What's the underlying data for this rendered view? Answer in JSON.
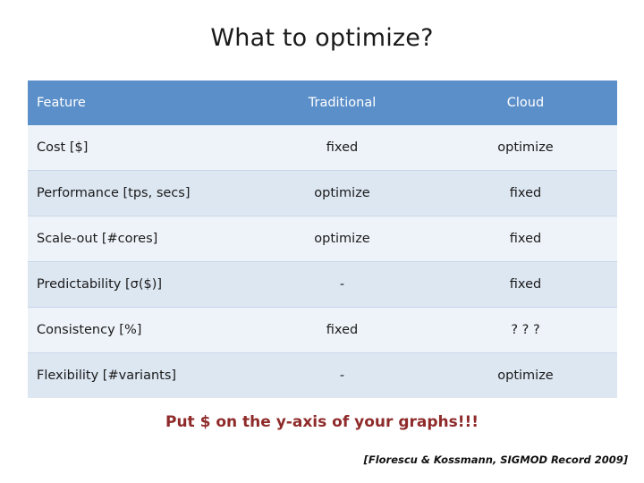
{
  "slide": {
    "title": "What to optimize?",
    "footnote": "Put $ on the y-axis of your graphs!!!",
    "citation": "[Florescu & Kossmann, SIGMOD Record 2009]"
  },
  "table": {
    "headers": [
      "Feature",
      "Traditional",
      "Cloud"
    ],
    "rows": [
      {
        "feature": "Cost [$]",
        "traditional": "fixed",
        "cloud": "optimize"
      },
      {
        "feature": "Performance [tps, secs]",
        "traditional": "optimize",
        "cloud": "fixed"
      },
      {
        "feature": "Scale-out [#cores]",
        "traditional": "optimize",
        "cloud": "fixed"
      },
      {
        "feature": "Predictability [σ($)]",
        "traditional": "-",
        "cloud": "fixed"
      },
      {
        "feature": "Consistency [%]",
        "traditional": "fixed",
        "cloud": "? ? ?"
      },
      {
        "feature": "Flexibility [#variants]",
        "traditional": "-",
        "cloud": "optimize"
      }
    ]
  },
  "colors": {
    "header_bg": "#5b8fc9",
    "row_light": "#eef3f9",
    "row_dark": "#dde7f2",
    "footnote": "#8f2a2a"
  }
}
